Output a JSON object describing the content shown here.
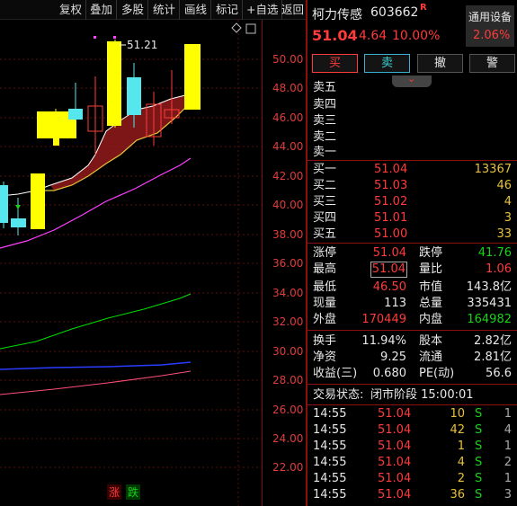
{
  "toolbar": {
    "items": [
      "复权",
      "叠加",
      "多股",
      "统计",
      "画线",
      "标记",
      "+自选",
      "返回"
    ]
  },
  "chart": {
    "y_ticks": [
      "50.00",
      "48.00",
      "46.00",
      "44.00",
      "42.00",
      "40.00",
      "38.00",
      "36.00",
      "34.00",
      "32.00",
      "30.00",
      "28.00",
      "26.00",
      "24.00",
      "22.00"
    ],
    "high_marker": "51.21",
    "footer": {
      "rise": "涨",
      "fall": "跌"
    },
    "colors": {
      "up": "#ffff00",
      "down": "#55e6ee",
      "ma1": "#ffffff",
      "ma2": "#ff40ff",
      "ma3": "#00ff00",
      "ma4": "#3344ff",
      "ma5": "#ff4f79"
    }
  },
  "stock": {
    "name": "柯力传感",
    "code": "603662",
    "tag": "R",
    "price": "51.04",
    "change": "4.64",
    "change_pct": "10.00%",
    "device_label": "通用设备",
    "device_pct": "2.06%"
  },
  "buttons": {
    "buy": "买",
    "sell": "卖",
    "cancel": "撤",
    "alert": "警"
  },
  "asks": [
    {
      "label": "卖五",
      "price": "",
      "vol": ""
    },
    {
      "label": "卖四",
      "price": "",
      "vol": ""
    },
    {
      "label": "卖三",
      "price": "",
      "vol": ""
    },
    {
      "label": "卖二",
      "price": "",
      "vol": ""
    },
    {
      "label": "卖一",
      "price": "",
      "vol": ""
    }
  ],
  "bids": [
    {
      "label": "买一",
      "price": "51.04",
      "vol": "13367"
    },
    {
      "label": "买二",
      "price": "51.03",
      "vol": "46"
    },
    {
      "label": "买三",
      "price": "51.02",
      "vol": "4"
    },
    {
      "label": "买四",
      "price": "51.01",
      "vol": "3"
    },
    {
      "label": "买五",
      "price": "51.00",
      "vol": "33"
    }
  ],
  "stats": {
    "limit_up_label": "涨停",
    "limit_up": "51.04",
    "limit_down_label": "跌停",
    "limit_down": "41.76",
    "high_label": "最高",
    "high": "51.04",
    "vol_ratio_label": "量比",
    "vol_ratio": "1.06",
    "low_label": "最低",
    "low": "46.50",
    "mkt_cap_label": "市值",
    "mkt_cap": "143.8亿",
    "last_vol_label": "现量",
    "last_vol": "113",
    "total_vol_label": "总量",
    "total_vol": "335431",
    "outer_label": "外盘",
    "outer": "170449",
    "inner_label": "内盘",
    "inner": "164982",
    "turnover_label": "换手",
    "turnover": "11.94%",
    "share_cap_label": "股本",
    "share_cap": "2.82亿",
    "nav_label": "净资",
    "nav": "9.25",
    "float_label": "流通",
    "float": "2.81亿",
    "eps_label": "收益(三)",
    "eps": "0.680",
    "pe_label": "PE(动)",
    "pe": "56.6"
  },
  "status": {
    "label": "交易状态:",
    "value": "闭市阶段 15:00:01"
  },
  "ticks": [
    {
      "time": "14:55",
      "price": "51.04",
      "vol": "10",
      "side": "S",
      "num": "1"
    },
    {
      "time": "14:55",
      "price": "51.04",
      "vol": "42",
      "side": "S",
      "num": "4"
    },
    {
      "time": "14:55",
      "price": "51.04",
      "vol": "1",
      "side": "S",
      "num": "1"
    },
    {
      "time": "14:55",
      "price": "51.04",
      "vol": "4",
      "side": "S",
      "num": "2"
    },
    {
      "time": "14:55",
      "price": "51.04",
      "vol": "2",
      "side": "S",
      "num": "1"
    },
    {
      "time": "14:55",
      "price": "51.04",
      "vol": "36",
      "side": "S",
      "num": "3"
    }
  ]
}
